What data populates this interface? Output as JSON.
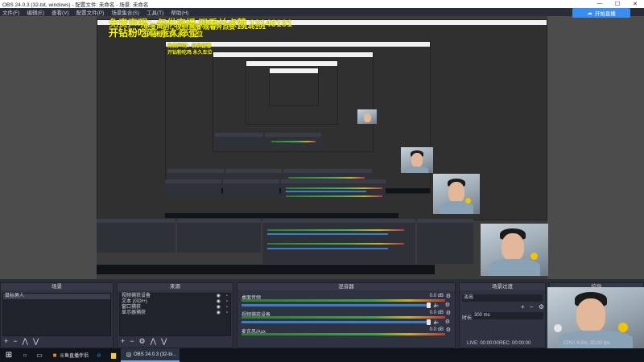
{
  "window": {
    "title": "OBS 24.0.3 (32-bit, windows) - 配置文件: 未命名 - 场景: 未命名",
    "minimize": "—",
    "maximize": "☐",
    "close": "✕"
  },
  "menu": {
    "items": [
      "文件(F)",
      "编辑(E)",
      "查看(V)",
      "配置文件(P)",
      "场景集合(S)",
      "工具(T)",
      "帮助(H)"
    ]
  },
  "overlay": {
    "line1": "免责声明：仅供直播  观看并点赞 13146191",
    "line2": "开钻粉吃鸡  永久车位",
    "line3": "免责声明：仅供直播  观看并点赞 13146191",
    "line4": "开钻粉吃鸡  永久车位",
    "line5": "免责声明：仅供直播",
    "line6": "开钻粉吃鸡  永久车位"
  },
  "live_button": "开始直播",
  "docks": {
    "scenes": {
      "title": "场景",
      "items": [
        "鼠标男人"
      ]
    },
    "sources": {
      "title": "来源",
      "items": [
        "视频捕获设备",
        "文本 (GDI+)",
        "窗口捕获",
        "显示器捕获"
      ]
    },
    "mixer": {
      "title": "混音器",
      "channels": [
        {
          "name": "桌面音频",
          "db": "0.0 dB"
        },
        {
          "name": "视频捕获设备",
          "db": "0.0 dB"
        },
        {
          "name": "麦克风/Aux",
          "db": "0.0 dB"
        }
      ]
    },
    "transitions": {
      "title": "场景过渡",
      "type": "淡出",
      "duration_label": "时长",
      "duration": "300 ms"
    },
    "controls": {
      "title": "控件"
    }
  },
  "footer": {
    "add": "+",
    "remove": "−",
    "settings": "⚙",
    "up": "⋀",
    "down": "⋁"
  },
  "status": {
    "live": "LIVE: 00:00:00",
    "rec": "REC: 00:00:00",
    "cpu": "CPU: 4.5%, 30.00 fps"
  },
  "taskbar": {
    "start": "⊞",
    "items": [
      {
        "label": "斗鱼直播伴侣"
      },
      {
        "label": "OBS 24.0.3 (32-bi..."
      }
    ]
  },
  "colors": {
    "overlay_text": "#ffff00",
    "accent": "#3a8df0",
    "background": "#2b2e38"
  }
}
